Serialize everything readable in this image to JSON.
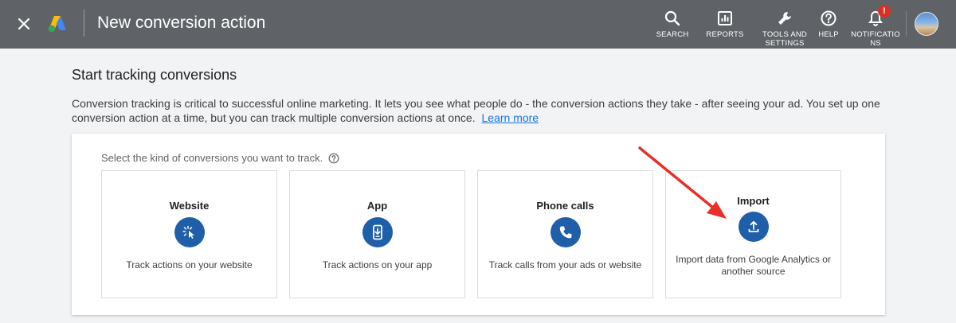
{
  "header": {
    "title": "New conversion action",
    "nav": [
      {
        "label": "SEARCH",
        "icon": "search-icon"
      },
      {
        "label": "REPORTS",
        "icon": "reports-icon"
      },
      {
        "label": "TOOLS AND SETTINGS",
        "icon": "wrench-icon"
      },
      {
        "label": "HELP",
        "icon": "help-icon"
      },
      {
        "label": "NOTIFICATIO NS",
        "icon": "bell-icon",
        "badge": "!"
      }
    ]
  },
  "main": {
    "heading": "Start tracking conversions",
    "description": "Conversion tracking is critical to successful online marketing. It lets you see what people do - the conversion actions they take - after seeing your ad. You set up one conversion action at a time, but you can track multiple conversion actions at once.",
    "learn_more": "Learn more",
    "prompt": "Select the kind of conversions you want to track.",
    "options": [
      {
        "title": "Website",
        "icon": "cursor-click-icon",
        "description": "Track actions on your website"
      },
      {
        "title": "App",
        "icon": "phone-download-icon",
        "description": "Track actions on your app"
      },
      {
        "title": "Phone calls",
        "icon": "phone-icon",
        "description": "Track calls from your ads or website"
      },
      {
        "title": "Import",
        "icon": "upload-icon",
        "description": "Import data from Google Analytics or another source"
      }
    ]
  },
  "colors": {
    "header_bg": "#5f6368",
    "icon_circle": "#1f5ea8",
    "link": "#1a73e8",
    "annotation_arrow": "#e8302a"
  }
}
